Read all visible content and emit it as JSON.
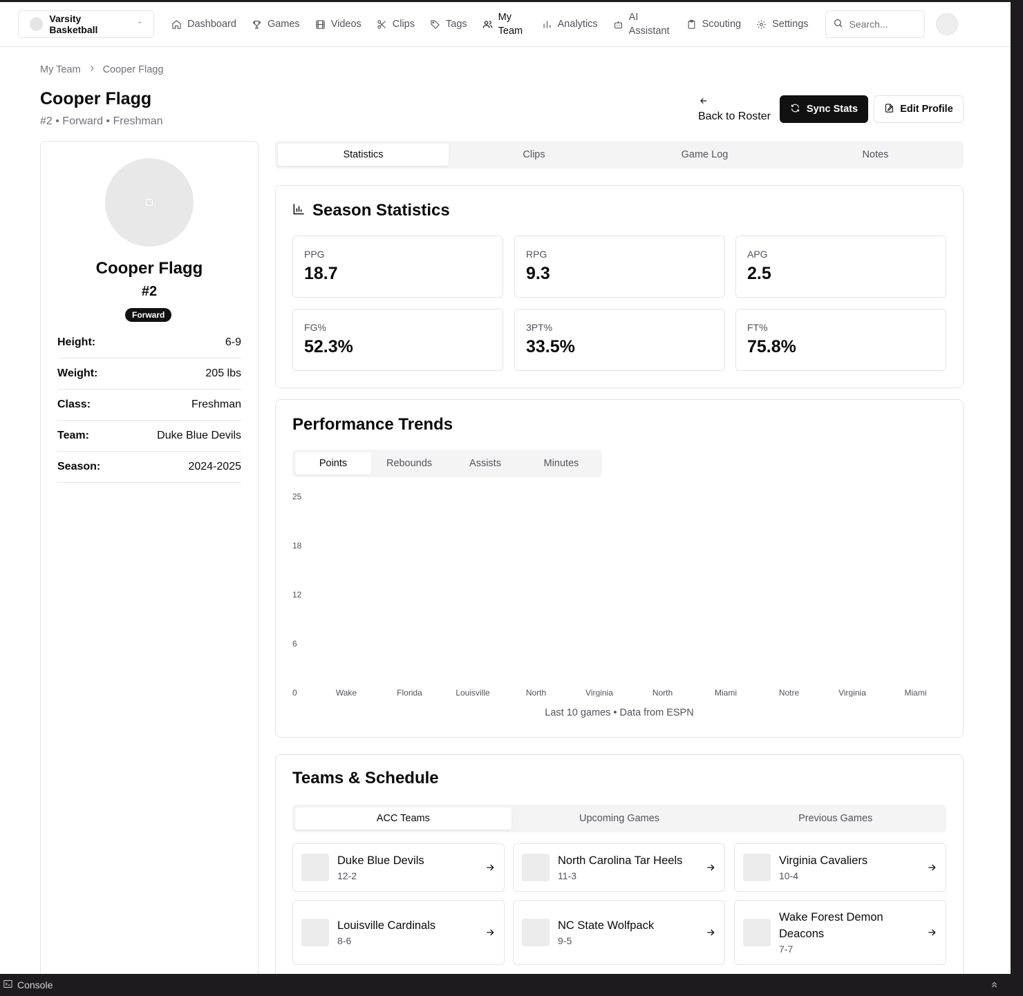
{
  "topbar": {
    "team_switcher": "Varsity Basketball",
    "nav": [
      {
        "label": "Dashboard",
        "icon": "home-icon"
      },
      {
        "label": "Games",
        "icon": "trophy-icon"
      },
      {
        "label": "Videos",
        "icon": "film-icon"
      },
      {
        "label": "Clips",
        "icon": "scissors-icon"
      },
      {
        "label": "Tags",
        "icon": "tag-icon"
      },
      {
        "label": "My Team",
        "icon": "users-icon"
      },
      {
        "label": "Analytics",
        "icon": "bar-chart-icon"
      },
      {
        "label": "AI Assistant",
        "icon": "bot-icon"
      },
      {
        "label": "Scouting",
        "icon": "clipboard-icon"
      },
      {
        "label": "Settings",
        "icon": "gear-icon"
      }
    ],
    "search_placeholder": "Search..."
  },
  "breadcrumb": [
    "My Team",
    "Cooper Flagg"
  ],
  "header": {
    "title": "Cooper Flagg",
    "subtitle": "#2 • Forward • Freshman",
    "back_label": "Back to Roster",
    "sync_label": "Sync Stats",
    "edit_label": "Edit Profile"
  },
  "profile": {
    "name": "Cooper Flagg",
    "number": "#2",
    "position": "Forward",
    "attributes": [
      {
        "key": "Height:",
        "value": "6-9"
      },
      {
        "key": "Weight:",
        "value": "205 lbs"
      },
      {
        "key": "Class:",
        "value": "Freshman"
      },
      {
        "key": "Team:",
        "value": "Duke Blue Devils"
      },
      {
        "key": "Season:",
        "value": "2024-2025"
      }
    ]
  },
  "tabs": [
    "Statistics",
    "Clips",
    "Game Log",
    "Notes"
  ],
  "season": {
    "title": "Season Statistics",
    "stats": [
      {
        "label": "PPG",
        "value": "18.7"
      },
      {
        "label": "RPG",
        "value": "9.3"
      },
      {
        "label": "APG",
        "value": "2.5"
      },
      {
        "label": "FG%",
        "value": "52.3%"
      },
      {
        "label": "3PT%",
        "value": "33.5%"
      },
      {
        "label": "FT%",
        "value": "75.8%"
      }
    ]
  },
  "trends": {
    "title": "Performance Trends",
    "tabs": [
      "Points",
      "Rebounds",
      "Assists",
      "Minutes"
    ],
    "note": "Last 10 games • Data from ESPN"
  },
  "chart_data": {
    "type": "bar",
    "categories": [
      "Wake",
      "Florida",
      "Louisville",
      "North",
      "Virginia",
      "North",
      "Miami",
      "Notre",
      "Virginia",
      "Miami"
    ],
    "values": [],
    "yticks": [
      "0",
      "6",
      "12",
      "18",
      "25"
    ],
    "ylim": [
      0,
      25
    ],
    "title": "",
    "xlabel": "",
    "ylabel": ""
  },
  "teams": {
    "title": "Teams & Schedule",
    "tabs": [
      "ACC Teams",
      "Upcoming Games",
      "Previous Games"
    ],
    "list": [
      {
        "name": "Duke Blue Devils",
        "record": "12-2"
      },
      {
        "name": "North Carolina Tar Heels",
        "record": "11-3"
      },
      {
        "name": "Virginia Cavaliers",
        "record": "10-4"
      },
      {
        "name": "Louisville Cardinals",
        "record": "8-6"
      },
      {
        "name": "NC State Wolfpack",
        "record": "9-5"
      },
      {
        "name": "Wake Forest Demon Deacons",
        "record": "7-7"
      }
    ]
  },
  "console": {
    "label": "Console"
  }
}
